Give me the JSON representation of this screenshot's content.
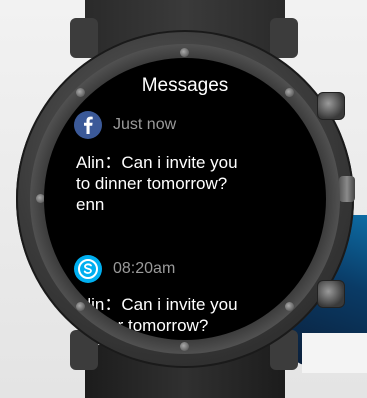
{
  "screen": {
    "title": "Messages"
  },
  "notifications": [
    {
      "app_icon": "facebook-icon",
      "time": "Just now",
      "message": "Alin：Can i invite you\nto dinner tomorrow?\nenn"
    },
    {
      "app_icon": "skype-icon",
      "time": "08:20am",
      "message": "Alin：Can i invite you\ndinner tomorrow?"
    }
  ],
  "colors": {
    "facebook": "#3b5998",
    "skype": "#00aff0",
    "time_text": "#9a9a9a",
    "screen_bg": "#000000"
  }
}
